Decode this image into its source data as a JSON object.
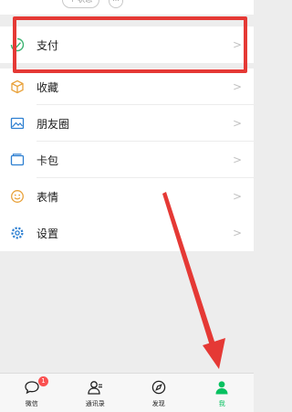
{
  "header": {
    "status_label": "+ 状态",
    "more_label": "…"
  },
  "menu": [
    {
      "id": "pay",
      "label": "支付",
      "icon": "pay-icon"
    },
    {
      "id": "favorites",
      "label": "收藏",
      "icon": "favorites-icon"
    },
    {
      "id": "moments",
      "label": "朋友圈",
      "icon": "moments-icon"
    },
    {
      "id": "cards",
      "label": "卡包",
      "icon": "card-wallet-icon"
    },
    {
      "id": "stickers",
      "label": "表情",
      "icon": "sticker-smile-icon"
    },
    {
      "id": "settings",
      "label": "设置",
      "icon": "settings-gear-icon"
    }
  ],
  "chevron": ">",
  "tabbar": {
    "tabs": [
      {
        "label": "微信",
        "icon": "chat-bubble-icon",
        "badge": "1"
      },
      {
        "label": "通讯录",
        "icon": "contacts-icon"
      },
      {
        "label": "发现",
        "icon": "compass-icon"
      },
      {
        "label": "我",
        "icon": "me-person-icon",
        "active": true
      }
    ]
  },
  "colors": {
    "accent_green": "#07c160",
    "annotation_red": "#e53935",
    "background": "#ededed",
    "badge_red": "#fa5151"
  }
}
